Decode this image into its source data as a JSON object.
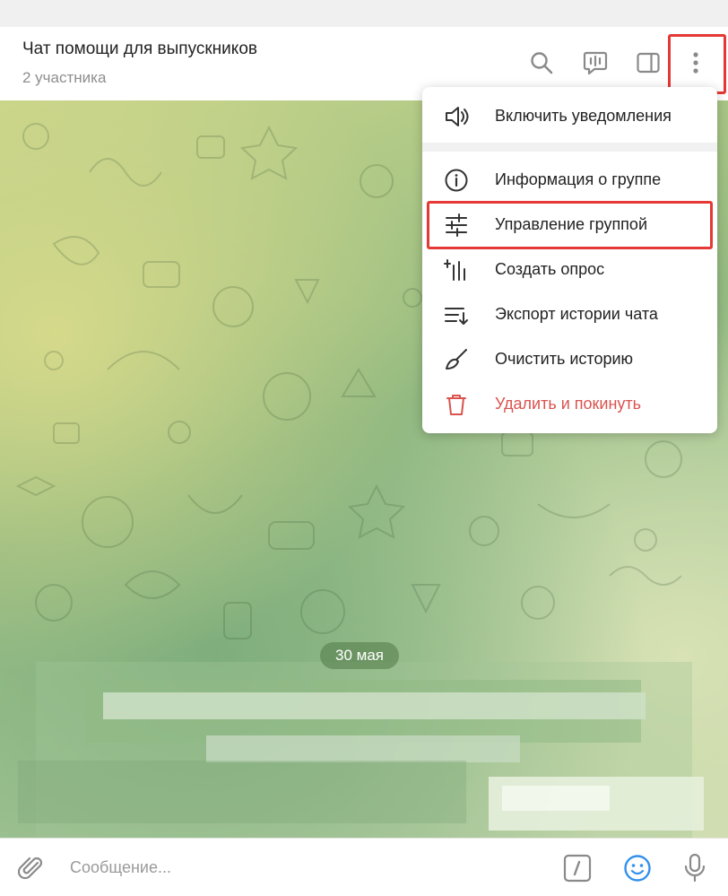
{
  "header": {
    "title": "Чат помощи для выпускников",
    "subtitle": "2 участника",
    "icons": [
      "search-icon",
      "voice-chat-icon",
      "sidebar-toggle-icon",
      "more-vertical-icon"
    ]
  },
  "menu": {
    "items": [
      {
        "label": "Включить уведомления",
        "icon": "speaker-icon"
      },
      {
        "label": "Информация о группе",
        "icon": "info-icon"
      },
      {
        "label": "Управление группой",
        "icon": "sliders-icon"
      },
      {
        "label": "Создать опрос",
        "icon": "poll-icon"
      },
      {
        "label": "Экспорт истории чата",
        "icon": "export-icon"
      },
      {
        "label": "Очистить историю",
        "icon": "broom-icon"
      },
      {
        "label": "Удалить и покинуть",
        "icon": "trash-icon"
      }
    ],
    "highlighted_item": "Управление группой"
  },
  "chat": {
    "date_label": "30 мая"
  },
  "composer": {
    "placeholder": "Сообщение...",
    "icons": [
      "attach-icon",
      "commands-icon",
      "emoji-icon",
      "microphone-icon"
    ]
  },
  "colors": {
    "highlight": "#e53935",
    "danger": "#d9534f",
    "accent": "#3390ec"
  }
}
